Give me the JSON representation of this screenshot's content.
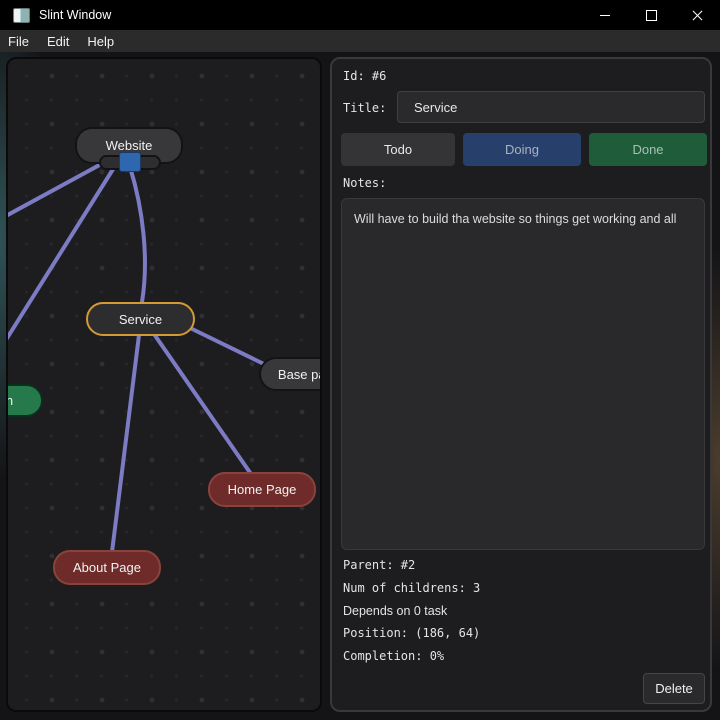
{
  "titlebar": {
    "title": "Slint Window"
  },
  "menubar": {
    "items": [
      {
        "label": "File"
      },
      {
        "label": "Edit"
      },
      {
        "label": "Help"
      }
    ]
  },
  "graph": {
    "nodes": [
      {
        "label": "Website",
        "color": "#38383b",
        "state": "normal"
      },
      {
        "label": "Service",
        "color": "#2d2d30",
        "state": "selected",
        "border": "#d49a33"
      },
      {
        "label": "Base page",
        "color": "#38383b",
        "state": "normal"
      },
      {
        "label": "n",
        "color": "#26794a",
        "state": "done"
      },
      {
        "label": "Home Page",
        "color": "#6e2b29",
        "state": "todo"
      },
      {
        "label": "About Page",
        "color": "#6e2b29",
        "state": "todo"
      }
    ],
    "edges": [
      "Website -> off-canvas-left",
      "Website -> off-canvas-lower-left",
      "Website -> Service",
      "Service -> Base page",
      "Service -> Home Page",
      "Service -> About Page"
    ],
    "edge_color": "#7c7bc4",
    "drag_handle_color": "#2e66b0"
  },
  "details": {
    "id_text": "Id: #6",
    "title_label": "Title:",
    "title_value": "Service",
    "status": [
      {
        "label": "Todo",
        "bg": "#343437"
      },
      {
        "label": "Doing",
        "bg": "#27406b"
      },
      {
        "label": "Done",
        "bg": "#1f5c3a"
      }
    ],
    "notes_label": "Notes:",
    "notes_value": "Will have to build tha website so things get working and all",
    "parent_text": "Parent: #2",
    "children_text": "Num of childrens: 3",
    "depends_text": "Depends on 0 task",
    "position_text": "Position: (186, 64)",
    "completion_text": "Completion: 0%",
    "delete_label": "Delete"
  }
}
